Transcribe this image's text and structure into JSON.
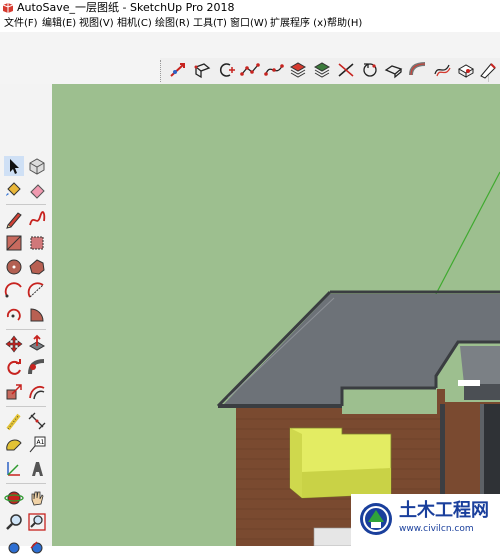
{
  "window": {
    "title": "AutoSave_一层图纸 - SketchUp Pro 2018",
    "app_icon": "sketchup-logo-icon"
  },
  "menu": [
    {
      "label": "文件(F)"
    },
    {
      "label": "编辑(E)"
    },
    {
      "label": "视图(V)"
    },
    {
      "label": "相机(C)"
    },
    {
      "label": "绘图(R)"
    },
    {
      "label": "工具(T)"
    },
    {
      "label": "窗口(W)"
    },
    {
      "label": "扩展程序 (x)"
    },
    {
      "label": "帮助(H)"
    }
  ],
  "top_toolbar": {
    "icons": [
      "freehand-arrow-icon",
      "rectangle-3d-icon",
      "arc-plus-icon",
      "polyline-dots-icon",
      "curve-dots-icon",
      "stack-layers-icon",
      "stack-layers-alt-icon",
      "cut-plane-icon",
      "rotate-object-icon",
      "push-shape-icon",
      "pipe-bend-icon",
      "offset-curve-icon",
      "box-eraser-icon",
      "section-knife-icon"
    ]
  },
  "left_toolbar": {
    "icons": [
      "select-arrow-icon",
      "component-icon",
      "paint-bucket-icon",
      "eraser-icon",
      "pencil-icon",
      "freehand-icon",
      "rectangle-icon",
      "rotated-rectangle-icon",
      "circle-icon",
      "polygon-icon",
      "arc-icon",
      "two-point-arc-icon",
      "three-point-arc-icon",
      "pie-icon",
      "move-icon",
      "push-pull-icon",
      "rotate-icon",
      "follow-me-icon",
      "scale-icon",
      "offset-icon",
      "tape-measure-icon",
      "dimension-icon",
      "protractor-icon",
      "text-icon",
      "axes-icon",
      "3d-text-icon",
      "orbit-icon",
      "pan-icon",
      "zoom-icon",
      "zoom-window-icon"
    ]
  },
  "colors": {
    "sky": "#9dbf8f",
    "roof": "#6d7278",
    "roof_edge": "#3a3d41",
    "brick": "#7a4a30",
    "window_glass": "#e3ec63",
    "axis_green": "#3faa2f"
  },
  "watermark": {
    "title": "土木工程网",
    "url": "www.civilcn.com"
  }
}
